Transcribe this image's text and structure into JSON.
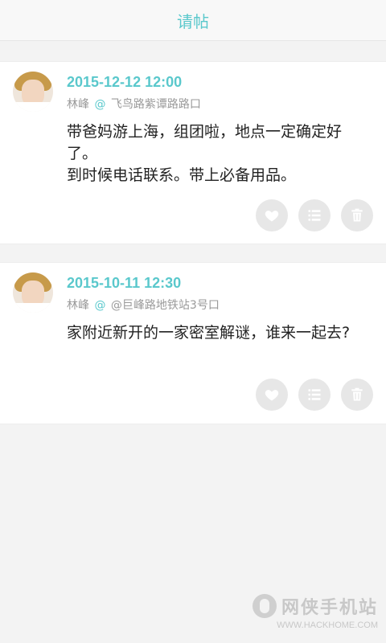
{
  "header": {
    "title": "请帖"
  },
  "posts": [
    {
      "date": "2015-12-12 12:00",
      "author": "林峰",
      "at_symbol": "@",
      "location": "飞鸟路紫谭路路口",
      "content_lines": [
        "带爸妈游上海，组团啦，地点一定确定好了。",
        "到时候电话联系。带上必备用品。"
      ]
    },
    {
      "date": "2015-10-11 12:30",
      "author": "林峰",
      "at_symbol": "@",
      "location": "@巨峰路地铁站3号口",
      "content_lines": [
        "家附近新开的一家密室解谜，谁来一起去?"
      ]
    }
  ],
  "actions": {
    "like_icon": "heart-icon",
    "list_icon": "list-icon",
    "delete_icon": "trash-icon"
  },
  "watermark": {
    "name": "网侠手机站",
    "url": "WWW.HACKHOME.COM"
  },
  "colors": {
    "accent": "#5ac8cc",
    "background": "#f3f3f3",
    "card": "#ffffff",
    "icon_button": "#e7e7e7",
    "meta_text": "#9a9a9a"
  }
}
